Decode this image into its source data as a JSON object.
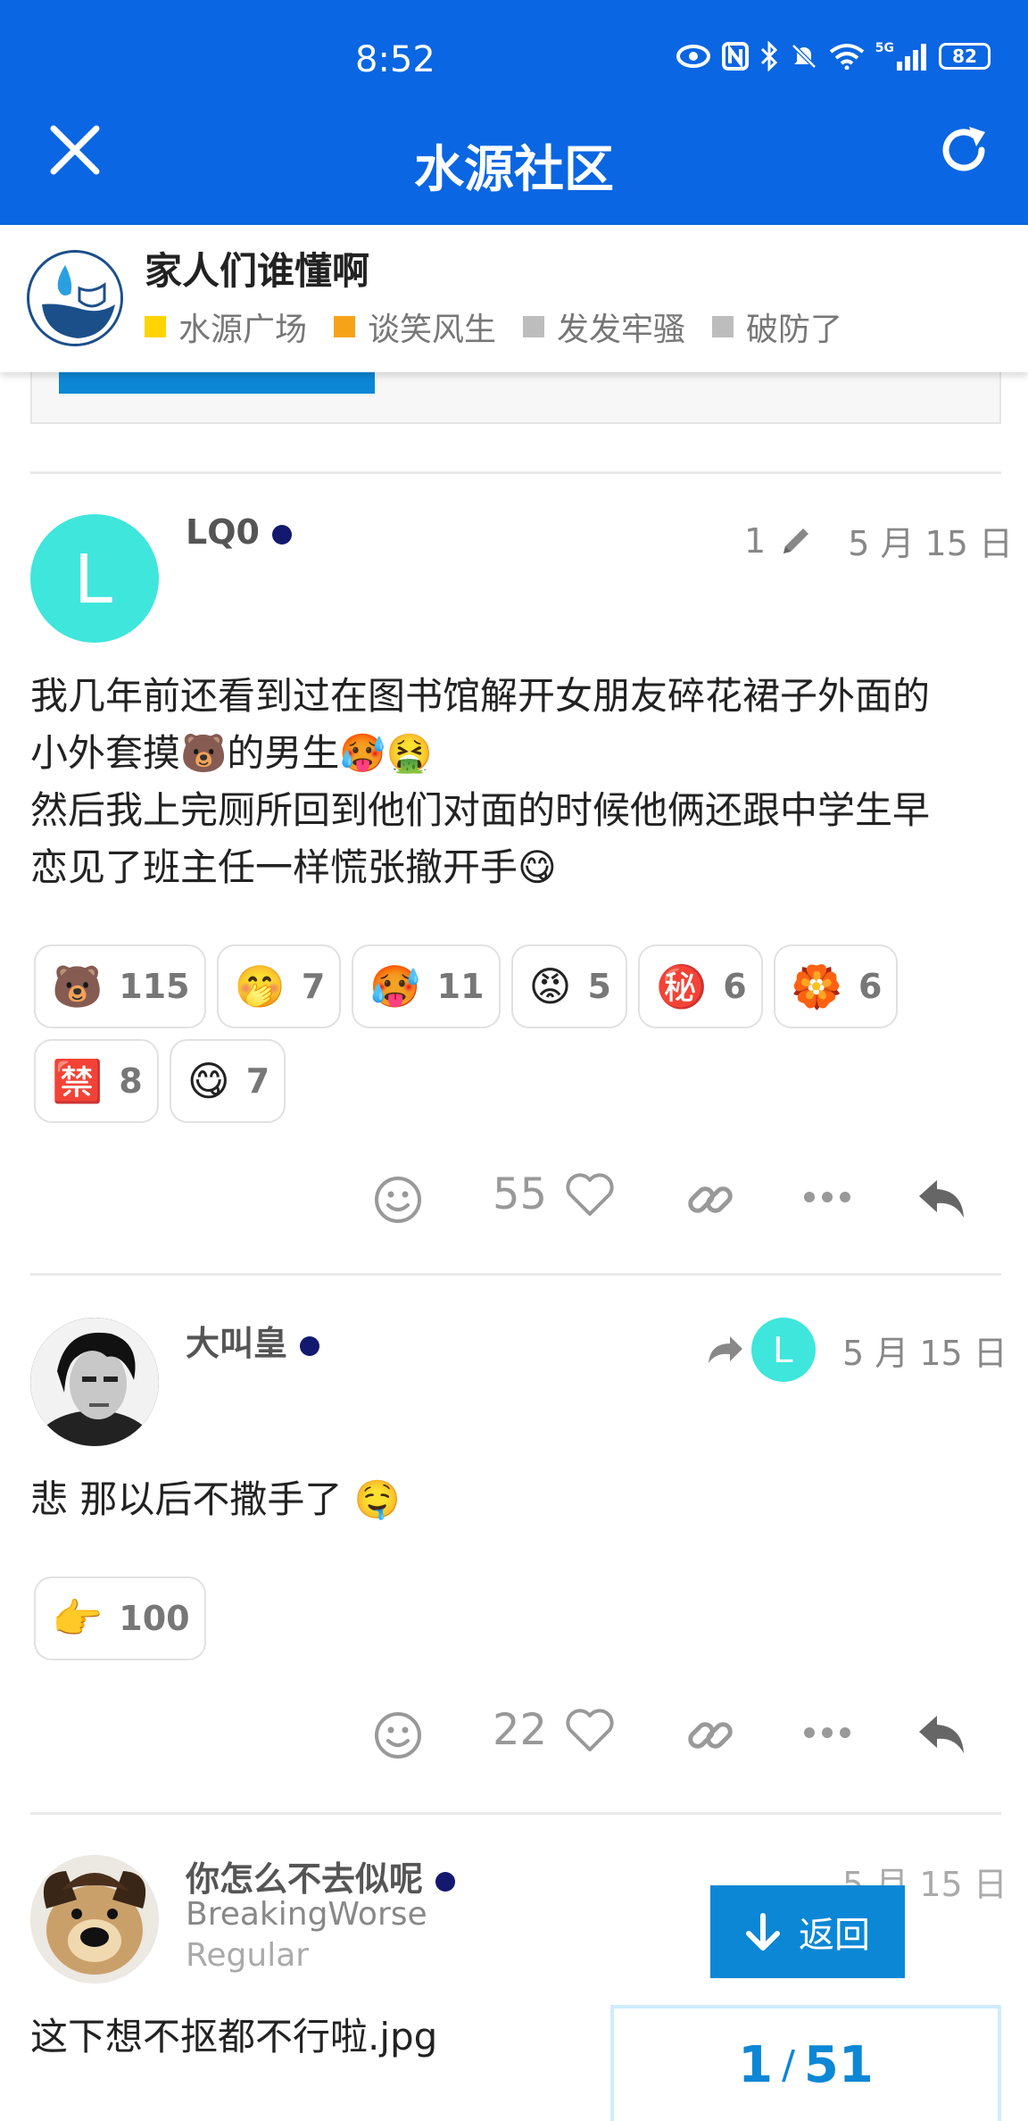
{
  "status_bar": {
    "time": "8:52",
    "battery": "82",
    "network": "5G"
  },
  "app": {
    "title": "水源社区",
    "close_icon": "close-icon",
    "refresh_icon": "refresh-icon"
  },
  "topic": {
    "title": "家人们谁懂啊",
    "categories": [
      {
        "label": "水源广场",
        "color": "#ffd400"
      },
      {
        "label": "谈笑风生",
        "color": "#f7a31a"
      },
      {
        "label": "发发牢骚",
        "color": "#bdbdbd"
      },
      {
        "label": "破防了",
        "color": "#bdbdbd"
      }
    ]
  },
  "posts": [
    {
      "avatar_letter": "L",
      "username": "LQ0",
      "edit_count": "1",
      "date": "5 月 15 日",
      "text_lines": [
        "我几年前还看到过在图书馆解开女朋友碎花裙子外面的",
        "小外套摸🐻的男生🥵🤮",
        "然后我上完厕所回到他们对面的时候他俩还跟中学生早",
        "恋见了班主任一样慌张撤开手😋"
      ],
      "reactions": [
        {
          "emoji": "🐻",
          "count": "115"
        },
        {
          "emoji": "🤭",
          "count": "7"
        },
        {
          "emoji": "🥵",
          "count": "11"
        },
        {
          "emoji": "😡",
          "count": "5"
        },
        {
          "emoji": "㊙️",
          "count": "6"
        },
        {
          "emoji": "🏵️",
          "count": "6"
        },
        {
          "emoji": "🈲",
          "count": "8"
        },
        {
          "emoji": "😋",
          "count": "7"
        }
      ],
      "likes": "55"
    },
    {
      "username": "大叫皇",
      "reply_to_letter": "L",
      "date": "5 月 15 日",
      "text": "悲 那以后不撒手了 🤤",
      "reactions": [
        {
          "emoji": "👉",
          "count": "100"
        }
      ],
      "likes": "22"
    },
    {
      "username": "你怎么不去似呢",
      "title": "BreakingWorse",
      "group": "Regular",
      "date": "5 月 15 日",
      "text": "这下想不抠都不行啦.jpg"
    }
  ],
  "back_button": "返回",
  "pager": {
    "current": "1",
    "total": "51",
    "separator": "/"
  },
  "colors": {
    "brand": "#0a66e2",
    "accent": "#0c87d5",
    "avatar_l": "#3ee6dc",
    "online": "#13196e"
  }
}
